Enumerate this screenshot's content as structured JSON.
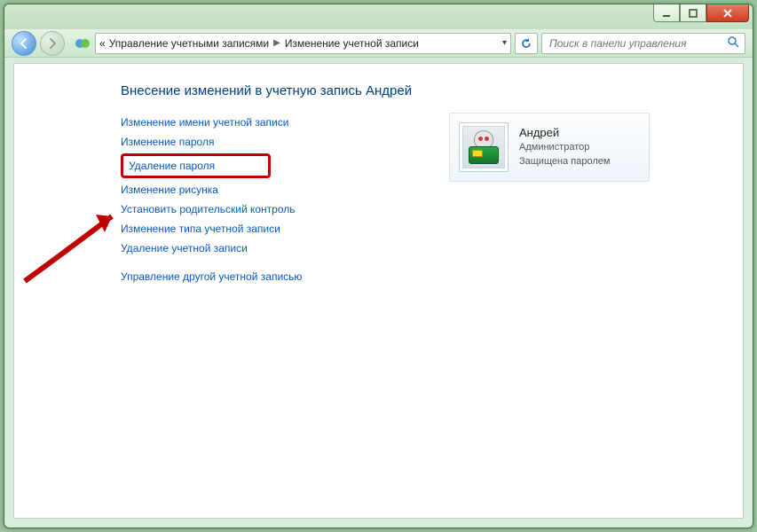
{
  "breadcrumb": {
    "prefix": "«",
    "part1": "Управление учетными записями",
    "part2": "Изменение учетной записи"
  },
  "search": {
    "placeholder": "Поиск в панели управления"
  },
  "page": {
    "title": "Внесение изменений в учетную запись Андрей"
  },
  "links": {
    "change_name": "Изменение имени учетной записи",
    "change_password": "Изменение пароля",
    "delete_password": "Удаление пароля",
    "change_picture": "Изменение рисунка",
    "parental_control": "Установить родительский контроль",
    "change_type": "Изменение типа учетной записи",
    "delete_account": "Удаление учетной записи",
    "manage_other": "Управление другой учетной записью"
  },
  "user": {
    "name": "Андрей",
    "role": "Администратор",
    "status": "Защищена паролем"
  }
}
